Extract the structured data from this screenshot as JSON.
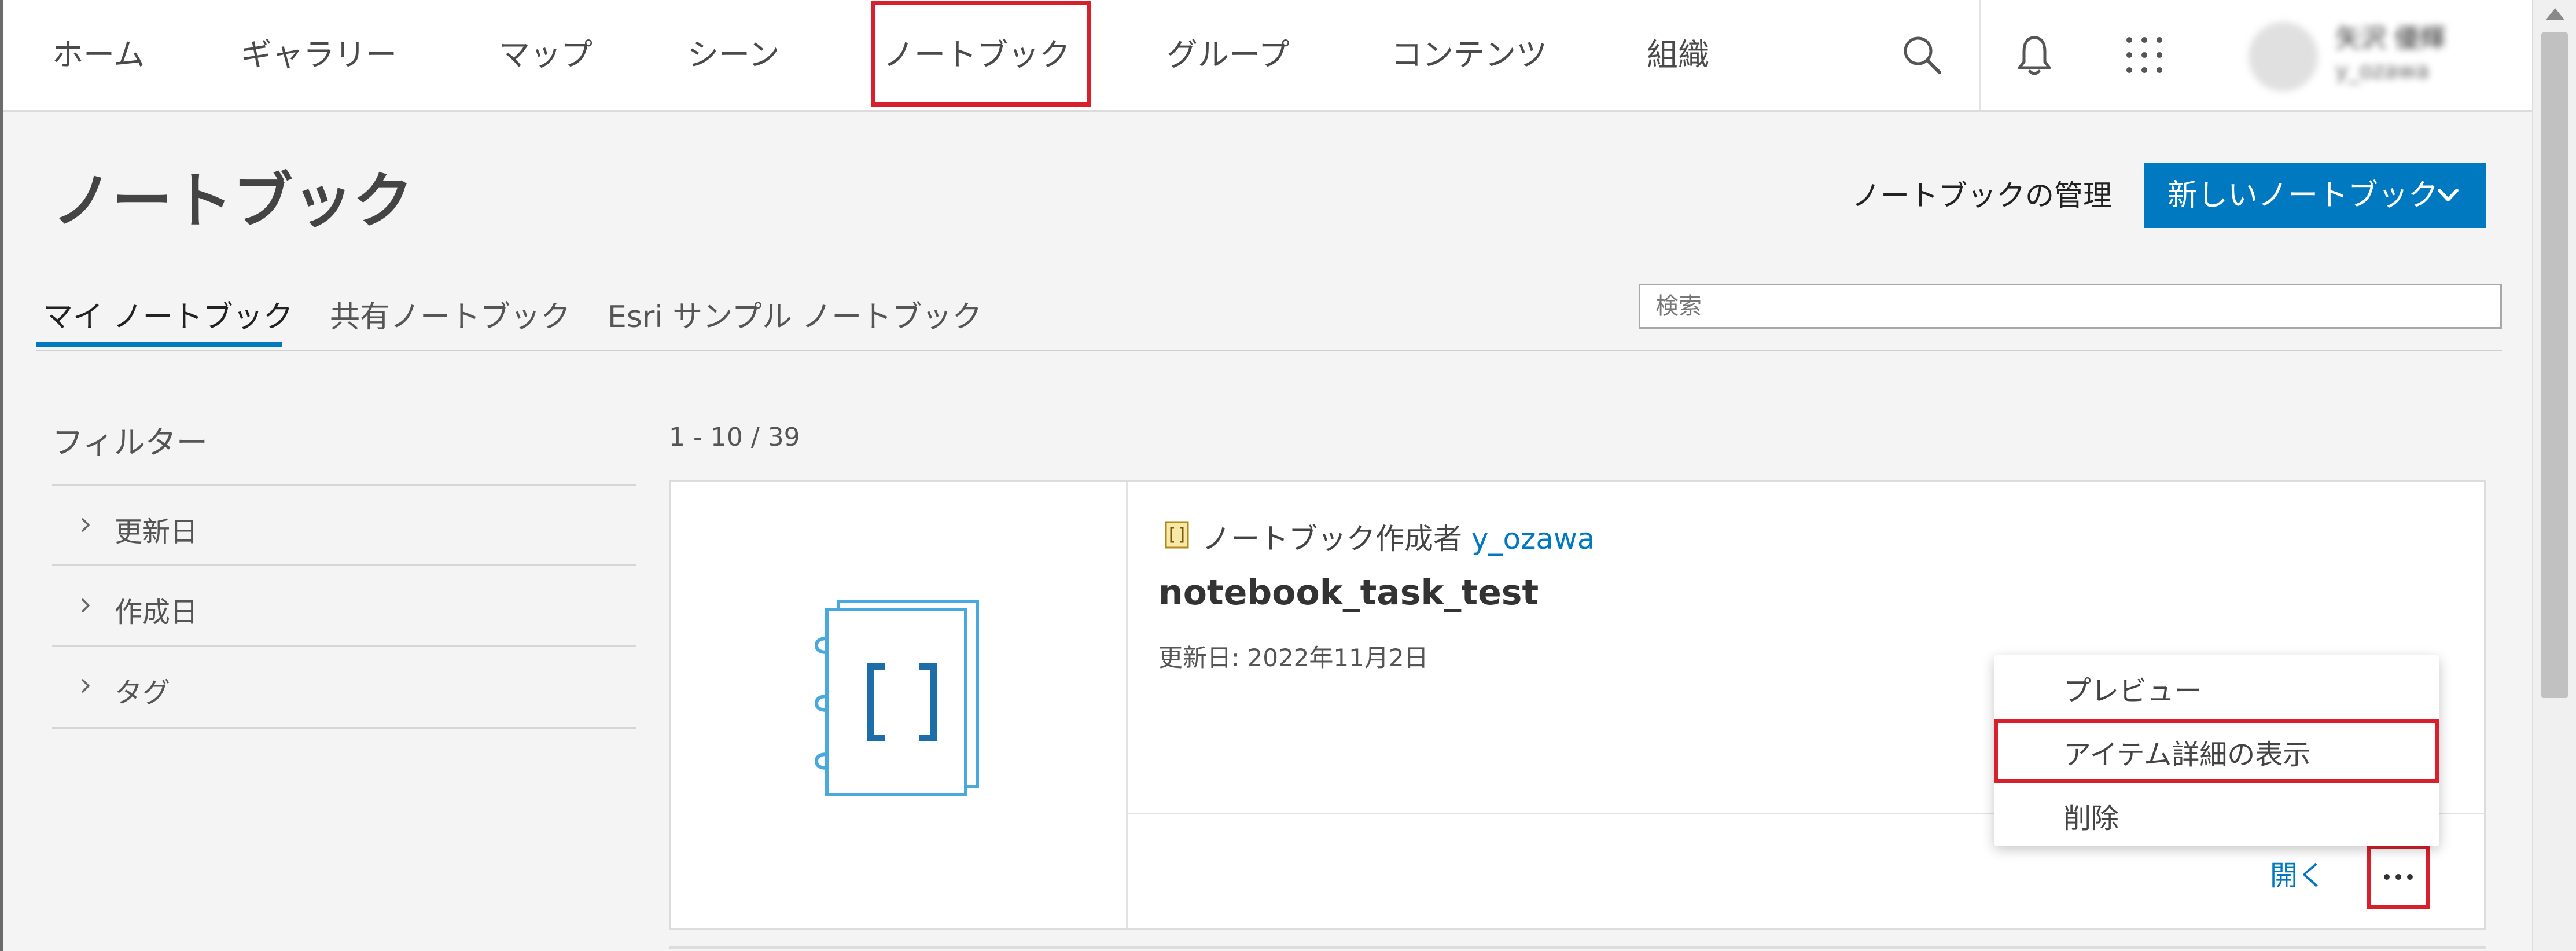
{
  "nav": {
    "items": [
      {
        "label": "ホーム"
      },
      {
        "label": "ギャラリー"
      },
      {
        "label": "マップ"
      },
      {
        "label": "シーン"
      },
      {
        "label": "ノートブック"
      },
      {
        "label": "グループ"
      },
      {
        "label": "コンテンツ"
      },
      {
        "label": "組織"
      }
    ],
    "icons": [
      "search-icon",
      "bell-icon",
      "apps-grid-icon"
    ],
    "user": {
      "name": "矢沢 優輝",
      "id": "y_ozawa"
    }
  },
  "page": {
    "title": "ノートブック",
    "manage_label": "ノートブックの管理",
    "new_button_label": "新しいノートブック"
  },
  "tabs": [
    {
      "label": "マイ ノートブック"
    },
    {
      "label": "共有ノートブック"
    },
    {
      "label": "Esri サンプル ノートブック"
    }
  ],
  "search": {
    "placeholder": "検索",
    "value": ""
  },
  "filter": {
    "title": "フィルター",
    "items": [
      {
        "label": "更新日"
      },
      {
        "label": "作成日"
      },
      {
        "label": "タグ"
      }
    ]
  },
  "results": {
    "count_text": "1 - 10 / 39",
    "cards": [
      {
        "type_label": "ノートブック作成者",
        "owner": "y_ozawa",
        "title": "notebook_task_test",
        "updated": "更新日: 2022年11月2日",
        "open_label": "開く",
        "menu": [
          {
            "label": "プレビュー"
          },
          {
            "label": "アイテム詳細の表示"
          },
          {
            "label": "削除"
          }
        ]
      }
    ]
  },
  "colors": {
    "accent": "#0079c1",
    "highlight": "#d8202c",
    "thumb_icon": "#4aa9dc",
    "thumb_bracket": "#1d6da8"
  }
}
